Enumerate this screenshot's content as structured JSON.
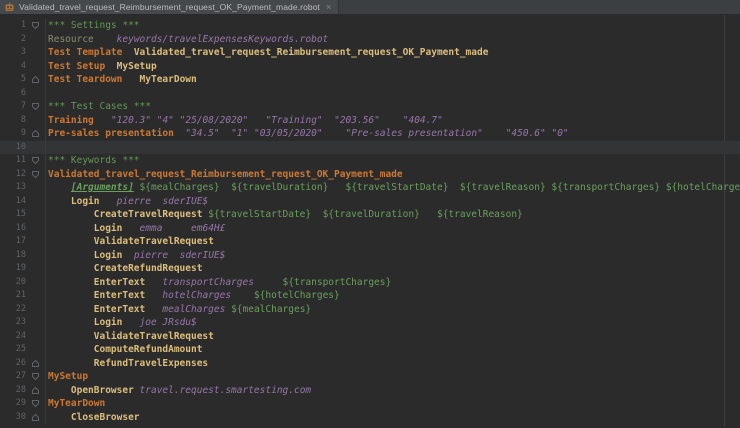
{
  "window": {
    "tab": {
      "title": "Validated_travel_request_Reimbursement_request_OK_Payment_made.robot",
      "icon": "robot-file-icon",
      "close_label": "×"
    }
  },
  "editor": {
    "language": "Robot Framework",
    "current_line": 10,
    "colors": {
      "background": "#2b2b2b",
      "tab_bar": "#3c3f41",
      "current_line_highlight": "#323436",
      "line_number": "#606366",
      "section_header": "#629755",
      "setting_keyword": "#cc7832",
      "keyword_call": "#dcbe7c",
      "string_argument": "#9876aa",
      "variable": "#69a05c",
      "import_keyword": "#8c8c6e"
    },
    "lines": [
      {
        "n": 1,
        "fold": "start",
        "tokens": [
          {
            "c": "sec",
            "t": "*** Settings ***"
          }
        ]
      },
      {
        "n": 2,
        "tokens": [
          {
            "c": "imp",
            "t": "Resource"
          },
          {
            "c": "pln",
            "t": "    "
          },
          {
            "c": "str",
            "t": "keywords/travelExpensesKeywords.robot"
          }
        ]
      },
      {
        "n": 3,
        "tokens": [
          {
            "c": "set",
            "t": "Test Template"
          },
          {
            "c": "pln",
            "t": "  "
          },
          {
            "c": "kw",
            "t": "Validated_travel_request_Reimbursement_request_OK_Payment_made"
          }
        ]
      },
      {
        "n": 4,
        "tokens": [
          {
            "c": "set",
            "t": "Test Setup"
          },
          {
            "c": "pln",
            "t": "  "
          },
          {
            "c": "kw",
            "t": "MySetup"
          }
        ]
      },
      {
        "n": 5,
        "fold": "end",
        "tokens": [
          {
            "c": "set",
            "t": "Test Teardown"
          },
          {
            "c": "pln",
            "t": "   "
          },
          {
            "c": "kw",
            "t": "MyTearDown"
          }
        ]
      },
      {
        "n": 6,
        "tokens": []
      },
      {
        "n": 7,
        "fold": "start",
        "tokens": [
          {
            "c": "sec",
            "t": "*** Test Cases ***"
          }
        ]
      },
      {
        "n": 8,
        "tokens": [
          {
            "c": "set",
            "t": "Training"
          },
          {
            "c": "pln",
            "t": "   "
          },
          {
            "c": "str",
            "t": "\"120.3\""
          },
          {
            "c": "pln",
            "t": " "
          },
          {
            "c": "str",
            "t": "\"4\""
          },
          {
            "c": "pln",
            "t": " "
          },
          {
            "c": "str",
            "t": "\"25/08/2020\""
          },
          {
            "c": "pln",
            "t": "   "
          },
          {
            "c": "str",
            "t": "\"Training\""
          },
          {
            "c": "pln",
            "t": "  "
          },
          {
            "c": "str",
            "t": "\"203.56\""
          },
          {
            "c": "pln",
            "t": "    "
          },
          {
            "c": "str",
            "t": "\"404.7\""
          }
        ]
      },
      {
        "n": 9,
        "fold": "end",
        "tokens": [
          {
            "c": "set",
            "t": "Pre-sales presentation"
          },
          {
            "c": "pln",
            "t": "  "
          },
          {
            "c": "str",
            "t": "\"34.5\""
          },
          {
            "c": "pln",
            "t": "  "
          },
          {
            "c": "str",
            "t": "\"1\""
          },
          {
            "c": "pln",
            "t": " "
          },
          {
            "c": "str",
            "t": "\"03/05/2020\""
          },
          {
            "c": "pln",
            "t": "    "
          },
          {
            "c": "str",
            "t": "\"Pre-sales presentation\""
          },
          {
            "c": "pln",
            "t": "    "
          },
          {
            "c": "str",
            "t": "\"450.6\""
          },
          {
            "c": "pln",
            "t": " "
          },
          {
            "c": "str",
            "t": "\"0\""
          }
        ]
      },
      {
        "n": 10,
        "tokens": []
      },
      {
        "n": 11,
        "fold": "start",
        "tokens": [
          {
            "c": "sec",
            "t": "*** Keywords ***"
          }
        ]
      },
      {
        "n": 12,
        "fold": "start",
        "tokens": [
          {
            "c": "set",
            "t": "Validated_travel_request_Reimbursement_request_OK_Payment_made"
          }
        ]
      },
      {
        "n": 13,
        "tokens": [
          {
            "c": "pln",
            "t": "    "
          },
          {
            "c": "arg",
            "t": "[Arguments]"
          },
          {
            "c": "pln",
            "t": " "
          },
          {
            "c": "var",
            "t": "${mealCharges}"
          },
          {
            "c": "pln",
            "t": "  "
          },
          {
            "c": "var",
            "t": "${travelDuration}"
          },
          {
            "c": "pln",
            "t": "   "
          },
          {
            "c": "var",
            "t": "${travelStartDate}"
          },
          {
            "c": "pln",
            "t": "  "
          },
          {
            "c": "var",
            "t": "${travelReason}"
          },
          {
            "c": "pln",
            "t": " "
          },
          {
            "c": "var",
            "t": "${transportCharges}"
          },
          {
            "c": "pln",
            "t": " "
          },
          {
            "c": "var",
            "t": "${hotelCharges}"
          }
        ]
      },
      {
        "n": 14,
        "tokens": [
          {
            "c": "pln",
            "t": "    "
          },
          {
            "c": "kw",
            "t": "Login"
          },
          {
            "c": "pln",
            "t": "   "
          },
          {
            "c": "str",
            "t": "pierre"
          },
          {
            "c": "pln",
            "t": "  "
          },
          {
            "c": "str",
            "t": "sderIUE$"
          }
        ]
      },
      {
        "n": 15,
        "tokens": [
          {
            "c": "pln",
            "t": "        "
          },
          {
            "c": "kw",
            "t": "CreateTravelRequest"
          },
          {
            "c": "pln",
            "t": " "
          },
          {
            "c": "var",
            "t": "${travelStartDate}"
          },
          {
            "c": "pln",
            "t": "  "
          },
          {
            "c": "var",
            "t": "${travelDuration}"
          },
          {
            "c": "pln",
            "t": "   "
          },
          {
            "c": "var",
            "t": "${travelReason}"
          }
        ]
      },
      {
        "n": 16,
        "tokens": [
          {
            "c": "pln",
            "t": "        "
          },
          {
            "c": "kw",
            "t": "Login"
          },
          {
            "c": "pln",
            "t": "   "
          },
          {
            "c": "str",
            "t": "emma"
          },
          {
            "c": "pln",
            "t": "     "
          },
          {
            "c": "str",
            "t": "em64H£"
          }
        ]
      },
      {
        "n": 17,
        "tokens": [
          {
            "c": "pln",
            "t": "        "
          },
          {
            "c": "kw",
            "t": "ValidateTravelRequest"
          }
        ]
      },
      {
        "n": 18,
        "tokens": [
          {
            "c": "pln",
            "t": "        "
          },
          {
            "c": "kw",
            "t": "Login"
          },
          {
            "c": "pln",
            "t": "  "
          },
          {
            "c": "str",
            "t": "pierre"
          },
          {
            "c": "pln",
            "t": "  "
          },
          {
            "c": "str",
            "t": "sderIUE$"
          }
        ]
      },
      {
        "n": 19,
        "tokens": [
          {
            "c": "pln",
            "t": "        "
          },
          {
            "c": "kw",
            "t": "CreateRefundRequest"
          }
        ]
      },
      {
        "n": 20,
        "tokens": [
          {
            "c": "pln",
            "t": "        "
          },
          {
            "c": "kw",
            "t": "EnterText"
          },
          {
            "c": "pln",
            "t": "   "
          },
          {
            "c": "str",
            "t": "transportCharges"
          },
          {
            "c": "pln",
            "t": "     "
          },
          {
            "c": "var",
            "t": "${transportCharges}"
          }
        ]
      },
      {
        "n": 21,
        "tokens": [
          {
            "c": "pln",
            "t": "        "
          },
          {
            "c": "kw",
            "t": "EnterText"
          },
          {
            "c": "pln",
            "t": "   "
          },
          {
            "c": "str",
            "t": "hotelCharges"
          },
          {
            "c": "pln",
            "t": "    "
          },
          {
            "c": "var",
            "t": "${hotelCharges}"
          }
        ]
      },
      {
        "n": 22,
        "tokens": [
          {
            "c": "pln",
            "t": "        "
          },
          {
            "c": "kw",
            "t": "EnterText"
          },
          {
            "c": "pln",
            "t": "   "
          },
          {
            "c": "str",
            "t": "mealCharges"
          },
          {
            "c": "pln",
            "t": " "
          },
          {
            "c": "var",
            "t": "${mealCharges}"
          }
        ]
      },
      {
        "n": 23,
        "tokens": [
          {
            "c": "pln",
            "t": "        "
          },
          {
            "c": "kw",
            "t": "Login"
          },
          {
            "c": "pln",
            "t": "   "
          },
          {
            "c": "str",
            "t": "joe JRsdu$"
          }
        ]
      },
      {
        "n": 24,
        "tokens": [
          {
            "c": "pln",
            "t": "        "
          },
          {
            "c": "kw",
            "t": "ValidateTravelRequest"
          }
        ]
      },
      {
        "n": 25,
        "tokens": [
          {
            "c": "pln",
            "t": "        "
          },
          {
            "c": "kw",
            "t": "ComputeRefundAmount"
          }
        ]
      },
      {
        "n": 26,
        "fold": "end",
        "tokens": [
          {
            "c": "pln",
            "t": "        "
          },
          {
            "c": "kw",
            "t": "RefundTravelExpenses"
          }
        ]
      },
      {
        "n": 27,
        "fold": "start",
        "tokens": [
          {
            "c": "set",
            "t": "MySetup"
          }
        ]
      },
      {
        "n": 28,
        "fold": "end",
        "tokens": [
          {
            "c": "pln",
            "t": "    "
          },
          {
            "c": "kw",
            "t": "OpenBrowser"
          },
          {
            "c": "pln",
            "t": " "
          },
          {
            "c": "str",
            "t": "travel.request.smartesting.com"
          }
        ]
      },
      {
        "n": 29,
        "fold": "start",
        "tokens": [
          {
            "c": "set",
            "t": "MyTearDown"
          }
        ]
      },
      {
        "n": 30,
        "fold": "end",
        "tokens": [
          {
            "c": "pln",
            "t": "    "
          },
          {
            "c": "kw",
            "t": "CloseBrowser"
          }
        ]
      }
    ]
  }
}
